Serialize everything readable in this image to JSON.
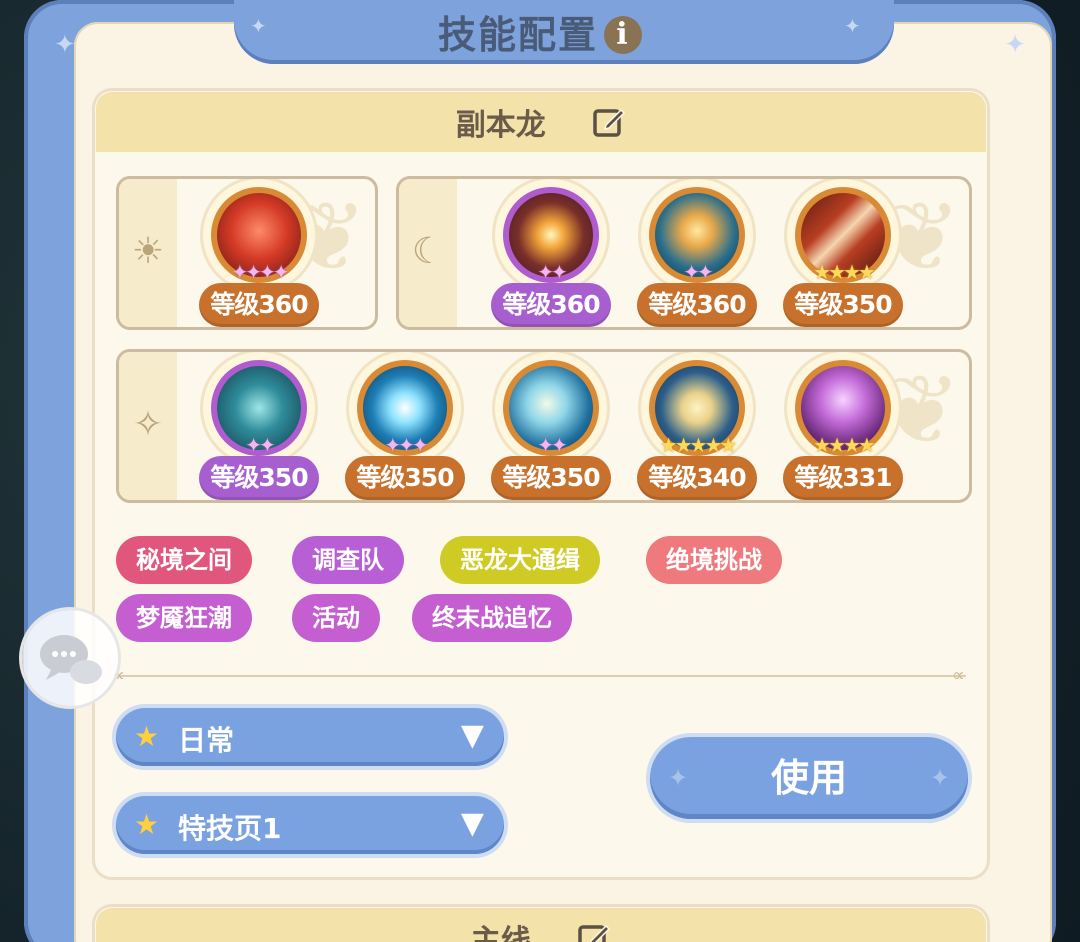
{
  "title": "技能配置",
  "info_icon": "info-icon",
  "panel": {
    "name": "副本龙",
    "edit_icon": "edit-icon"
  },
  "groups": [
    {
      "icon": "sun-icon",
      "skills": [
        {
          "level": "等级360",
          "stars": "✦✦✦✦",
          "star_color": "pink",
          "badge_color": "orange",
          "art": "red-coral"
        }
      ]
    },
    {
      "icon": "moon-icon",
      "skills": [
        {
          "level": "等级360",
          "stars": "✦✦",
          "star_color": "pink",
          "badge_color": "purple",
          "art": "golden-star-burst"
        },
        {
          "level": "等级360",
          "stars": "✦✦",
          "star_color": "pink",
          "badge_color": "orange",
          "art": "figure-in-light"
        },
        {
          "level": "等级350",
          "stars": "★★★★",
          "star_color": "gold",
          "badge_color": "orange",
          "art": "claw-slash"
        }
      ]
    },
    {
      "icon": "sparkle-icon",
      "skills": [
        {
          "level": "等级350",
          "stars": "✦✦",
          "star_color": "pink",
          "badge_color": "purple",
          "art": "teal-dragon"
        },
        {
          "level": "等级350",
          "stars": "✦✦✦",
          "star_color": "pink",
          "badge_color": "orange",
          "art": "blue-shatter"
        },
        {
          "level": "等级350",
          "stars": "✦✦",
          "star_color": "pink",
          "badge_color": "orange",
          "art": "beast-leap"
        },
        {
          "level": "等级340",
          "stars": "★★★★★",
          "star_color": "gold",
          "badge_color": "orange",
          "art": "heart-shield"
        },
        {
          "level": "等级331",
          "stars": "★★★★",
          "star_color": "gold",
          "badge_color": "orange",
          "art": "purple-target"
        }
      ]
    }
  ],
  "tags": [
    {
      "label": "秘境之间",
      "color": "#e0567d"
    },
    {
      "label": "调查队",
      "color": "#b95fd6"
    },
    {
      "label": "恶龙大通缉",
      "color": "#cfcb24"
    },
    {
      "label": "绝境挑战",
      "color": "#ee7a7e"
    },
    {
      "label": "梦魇狂潮",
      "color": "#c45ed1"
    },
    {
      "label": "活动",
      "color": "#c45ed1"
    },
    {
      "label": "终末战追忆",
      "color": "#c45ed1"
    }
  ],
  "dropdowns": [
    {
      "label": "日常",
      "icon": "star-icon",
      "chevron": "▼"
    },
    {
      "label": "特技页1",
      "icon": "star-icon",
      "chevron": "▼"
    }
  ],
  "use_button": "使用",
  "next_panel": {
    "name": "主线"
  },
  "colors": {
    "frame": "#7ea2db",
    "panel_bg": "#fdf8ec",
    "header_bg": "#f3e3ab",
    "badge_orange": "#c7712d",
    "badge_purple": "#a75fd0"
  }
}
